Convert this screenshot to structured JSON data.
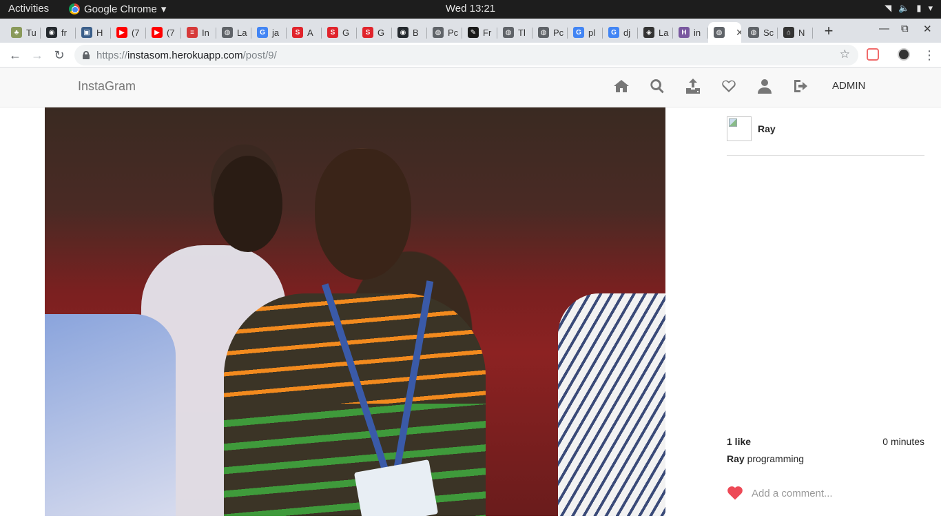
{
  "os": {
    "activities": "Activities",
    "app_name": "Google Chrome",
    "clock": "Wed 13:21"
  },
  "tabs": [
    {
      "label": "Tu",
      "icon": "tree-icon",
      "color": "#8a9a5b"
    },
    {
      "label": "fr",
      "icon": "github-icon",
      "color": "#24292e"
    },
    {
      "label": "H",
      "icon": "window-icon",
      "color": "#3b5f8a"
    },
    {
      "label": "(7",
      "icon": "youtube-icon",
      "color": "#ff0000"
    },
    {
      "label": "(7",
      "icon": "youtube-icon",
      "color": "#ff0000"
    },
    {
      "label": "In",
      "icon": "stack-icon",
      "color": "#d63a3a"
    },
    {
      "label": "La",
      "icon": "globe-icon",
      "color": "#5f6368"
    },
    {
      "label": "ja",
      "icon": "google-icon",
      "color": "#4285f4"
    },
    {
      "label": "A",
      "icon": "s-icon",
      "color": "#e0242c"
    },
    {
      "label": "G",
      "icon": "s-icon",
      "color": "#e0242c"
    },
    {
      "label": "G",
      "icon": "s-icon",
      "color": "#e0242c"
    },
    {
      "label": "B",
      "icon": "github-icon",
      "color": "#24292e"
    },
    {
      "label": "Pc",
      "icon": "globe-icon",
      "color": "#5f6368"
    },
    {
      "label": "Fr",
      "icon": "django-icon",
      "color": "#1a1a1a"
    },
    {
      "label": "Tl",
      "icon": "globe-icon",
      "color": "#5f6368"
    },
    {
      "label": "Pc",
      "icon": "globe-icon",
      "color": "#5f6368"
    },
    {
      "label": "pl",
      "icon": "google-icon",
      "color": "#4285f4"
    },
    {
      "label": "dj",
      "icon": "google-icon",
      "color": "#4285f4"
    },
    {
      "label": "La",
      "icon": "shield-icon",
      "color": "#333333"
    },
    {
      "label": "in",
      "icon": "heroku-icon",
      "color": "#79589f"
    },
    {
      "label": "",
      "icon": "globe-icon",
      "color": "#5f6368",
      "active": true
    },
    {
      "label": "Sc",
      "icon": "globe-icon",
      "color": "#5f6368"
    },
    {
      "label": "N",
      "icon": "home-icon",
      "color": "#333333"
    }
  ],
  "address": {
    "scheme": "https://",
    "host": "instasom.herokuapp.com",
    "path": "/post/9/"
  },
  "site": {
    "brand": "InstaGram",
    "nav_icons": [
      "home-icon",
      "search-icon",
      "upload-icon",
      "heart-icon",
      "user-icon",
      "logout-icon"
    ],
    "admin_label": "ADMIN"
  },
  "post": {
    "username": "Ray",
    "likes": "1 like",
    "time": "0 minutes",
    "caption_user": "Ray",
    "caption_text": "programming",
    "comment_placeholder": "Add a comment...",
    "like_color": "#ed4956"
  }
}
